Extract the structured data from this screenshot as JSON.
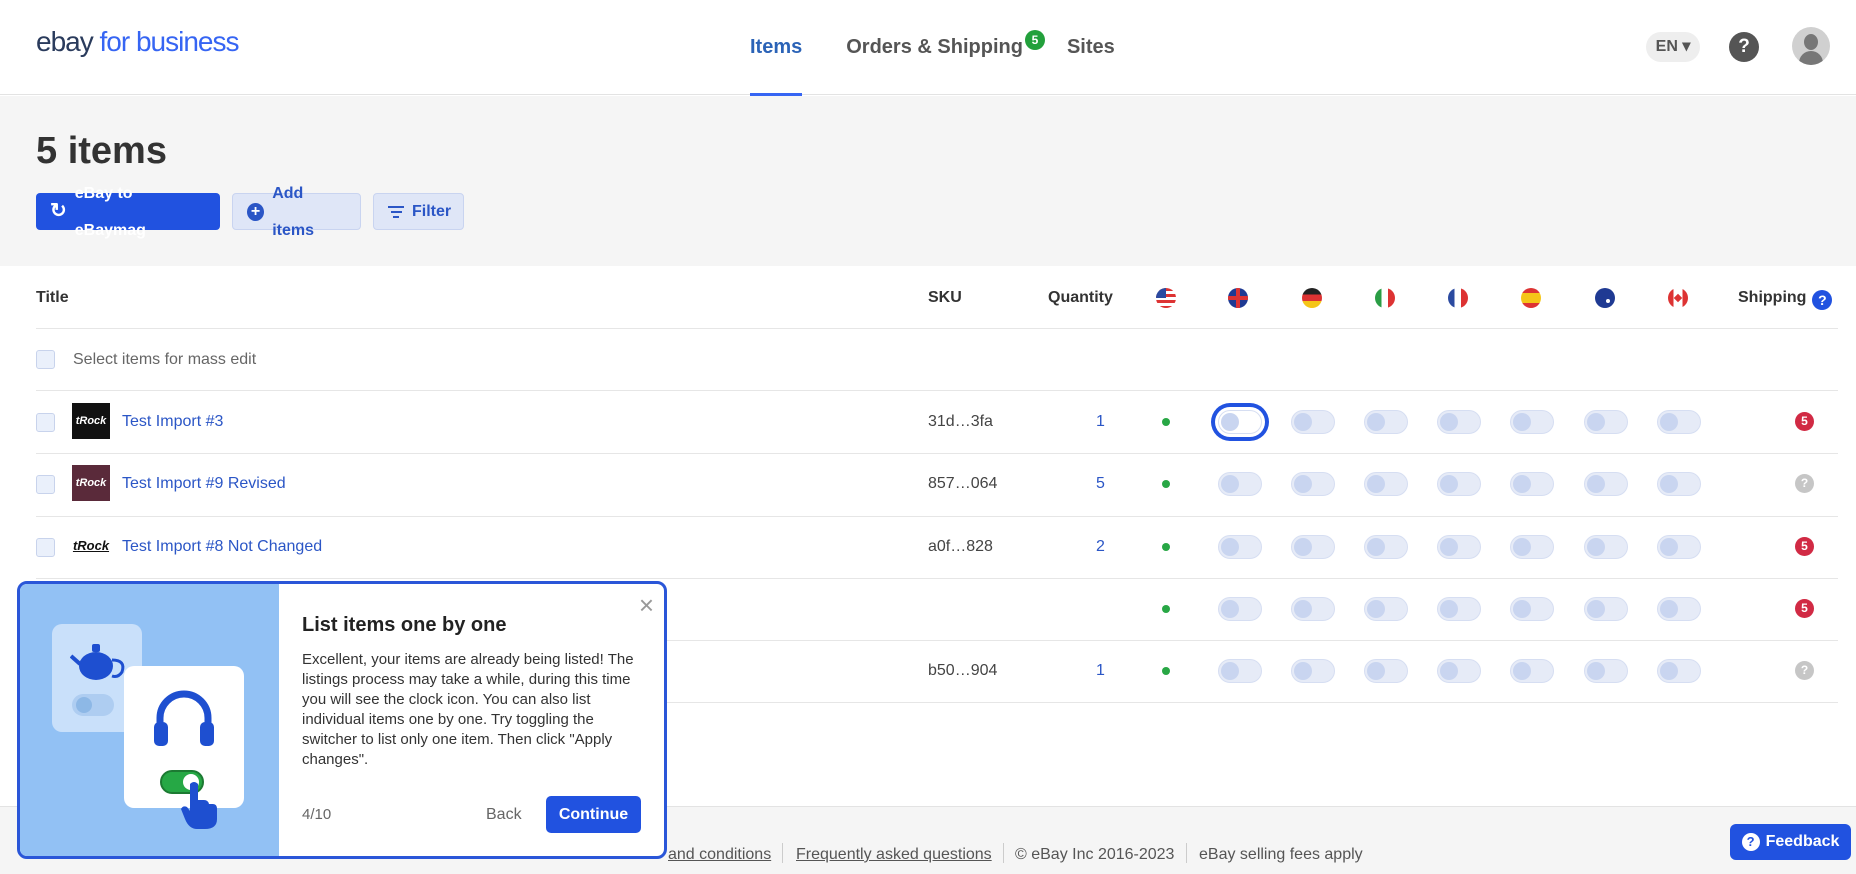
{
  "header": {
    "logo_ebay": "ebay",
    "logo_business": "for business",
    "nav": [
      {
        "label": "Items",
        "active": true
      },
      {
        "label": "Orders & Shipping",
        "badge": "5"
      },
      {
        "label": "Sites"
      }
    ],
    "language": "EN ▾",
    "help": "?"
  },
  "page": {
    "title": "5 items",
    "buttons": {
      "refresh": "eBay to eBaymag",
      "add": "Add items",
      "filter": "Filter"
    }
  },
  "table": {
    "columns": {
      "title": "Title",
      "sku": "SKU",
      "quantity": "Quantity",
      "shipping": "Shipping"
    },
    "sites": [
      "us-flag",
      "uk-flag",
      "de-flag",
      "it-flag",
      "fr-flag",
      "es-flag",
      "au-flag",
      "ca-flag"
    ],
    "mass_edit": "Select items for mass edit",
    "rows": [
      {
        "title": "Test Import #3",
        "sku": "31d…3fa",
        "quantity": "1",
        "shipping": "5"
      },
      {
        "title": "Test Import #9 Revised",
        "sku": "857…064",
        "quantity": "5",
        "shipping": "?"
      },
      {
        "title": "Test Import #8 Not Changed",
        "sku": "a0f…828",
        "quantity": "2",
        "shipping": "5"
      },
      {
        "title": "",
        "sku": "",
        "quantity": "",
        "shipping": "5"
      },
      {
        "title": "",
        "sku": "b50…904",
        "quantity": "1",
        "shipping": "?"
      }
    ],
    "thumb_text": "tRock"
  },
  "footer": {
    "terms": "and conditions",
    "faq": "Frequently asked questions",
    "copyright": "© eBay Inc 2016-2023",
    "fees": "eBay selling fees apply",
    "feedback": "Feedback"
  },
  "popup": {
    "title": "List items one by one",
    "body": "Excellent, your items are already being listed! The listings process may take a while, during this time you will see the clock icon. You can also list individual items one by one. Try toggling the switcher to list only one item. Then click \"Apply changes\".",
    "step": "4/10",
    "back": "Back",
    "continue": "Continue",
    "close": "×"
  },
  "colors": {
    "primary": "#2152e0",
    "link": "#2b56c6",
    "badge_green": "#23a03c",
    "badge_red": "#d12a44"
  }
}
